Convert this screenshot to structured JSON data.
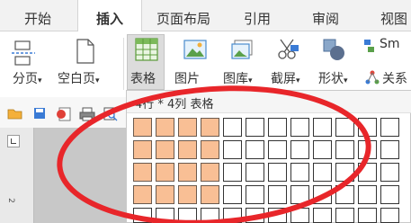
{
  "tabs": [
    {
      "label": "开始",
      "active": false
    },
    {
      "label": "插入",
      "active": true
    },
    {
      "label": "页面布局",
      "active": false
    },
    {
      "label": "引用",
      "active": false
    },
    {
      "label": "审阅",
      "active": false
    },
    {
      "label": "视图",
      "active": false
    }
  ],
  "ribbon": {
    "page_break": "分页",
    "blank_page": "空白页",
    "table": "表格",
    "picture": "图片",
    "gallery": "图库",
    "screenshot": "截屏",
    "shapes": "形状",
    "relation": "关系",
    "smartart": "Sm"
  },
  "dropdown": {
    "title": "4行 * 4列 表格",
    "selected_rows": 4,
    "selected_cols": 4
  },
  "ruler": {
    "number": "2"
  },
  "colors": {
    "selected_cell": "#f9bf95",
    "annotation_circle": "#e8262a",
    "tab_bar": "#f2f2f2",
    "doc_background": "#c8c8c8"
  },
  "icons": [
    "page-break-icon",
    "blank-page-icon",
    "table-icon",
    "picture-icon",
    "gallery-icon",
    "screenshot-icon",
    "shapes-icon",
    "relation-icon",
    "smartart-icon",
    "open-folder-icon",
    "save-icon",
    "export-pdf-icon",
    "print-icon",
    "print-preview-icon"
  ]
}
